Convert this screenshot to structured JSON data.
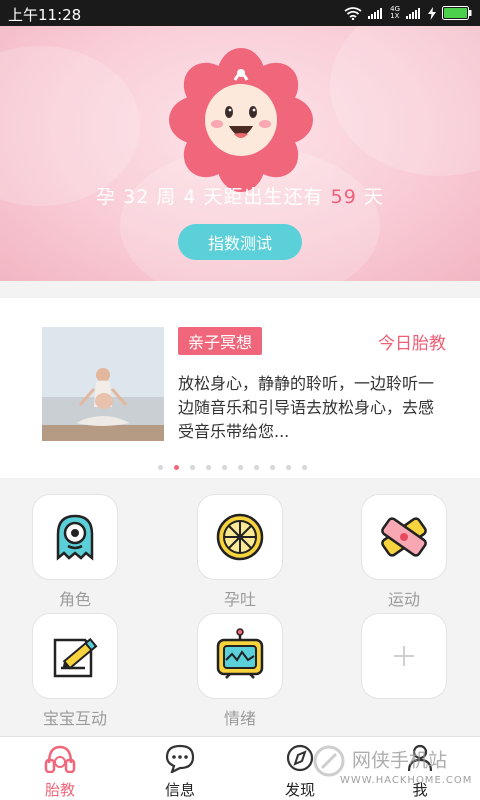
{
  "status_bar": {
    "time": "上午11:28",
    "network": "4G",
    "network_sub": "1X"
  },
  "hero": {
    "countdown_prefix": "孕 32 周 4 天距出生还有",
    "days_left": "59",
    "days_unit": "天",
    "test_button": "指数测试"
  },
  "card": {
    "tag": "亲子冥想",
    "link": "今日胎教",
    "description": "放松身心，静静的聆听，一边聆听一边随音乐和引导语去放松身心，去感受音乐带给您..."
  },
  "grid": {
    "items": [
      {
        "label": "角色",
        "icon": "monster-icon"
      },
      {
        "label": "孕吐",
        "icon": "lemon-icon"
      },
      {
        "label": "运动",
        "icon": "bandage-icon"
      },
      {
        "label": "宝宝互动",
        "icon": "note-pencil-icon"
      },
      {
        "label": "情绪",
        "icon": "tv-icon"
      },
      {
        "label": "",
        "icon": "add-icon"
      }
    ]
  },
  "tabs": [
    {
      "label": "胎教",
      "icon": "headphones-icon",
      "active": true
    },
    {
      "label": "信息",
      "icon": "chat-icon"
    },
    {
      "label": "发现",
      "icon": "compass-icon"
    },
    {
      "label": "我",
      "icon": "person-icon"
    }
  ],
  "watermark": {
    "text": "网侠手机站",
    "url": "WWW.HACKHOME.COM"
  },
  "colors": {
    "accent_pink": "#f0677b",
    "accent_teal": "#5cd0d8"
  }
}
